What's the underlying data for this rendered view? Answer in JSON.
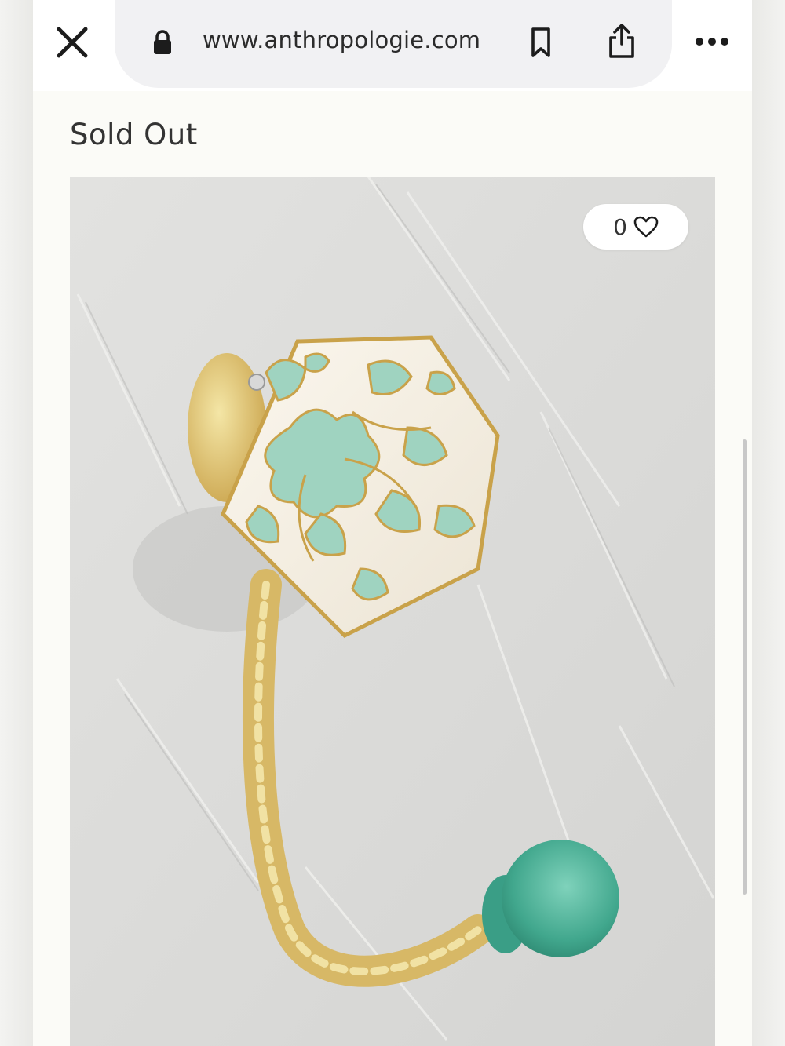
{
  "browser": {
    "url": "www.anthropologie.com",
    "icons": {
      "close": "close-icon",
      "lock": "lock-icon",
      "bookmark": "bookmark-icon",
      "share": "share-icon",
      "more": "more-icon"
    }
  },
  "product": {
    "status": "Sold Out",
    "like_count": "0",
    "image_alt": "",
    "colors": {
      "wall": "#dcdcda",
      "porcelain": "#f4efe4",
      "mint": "#9fd3c0",
      "gold": "#c9a24a",
      "teal_knob": "#4fb39a"
    }
  }
}
